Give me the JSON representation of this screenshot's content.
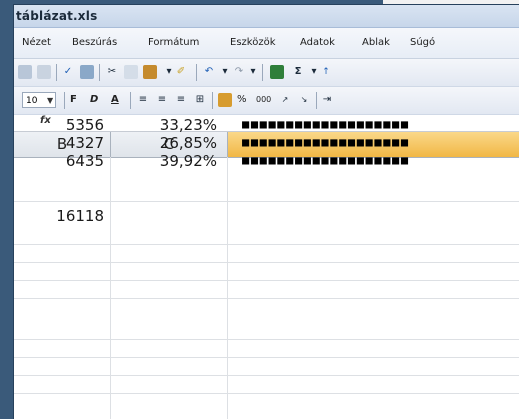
{
  "window": {
    "title": "táblázat.xls"
  },
  "menu": [
    "Nézet",
    "Beszúrás",
    "Formátum",
    "Eszközök",
    "Adatok",
    "Ablak",
    "Súgó"
  ],
  "toolbar": {
    "font_size": "10",
    "bold": "F",
    "italic": "D",
    "underline": "A",
    "percent": "%",
    "thousands": "000",
    "sigma": "Σ"
  },
  "formula_bar": {
    "fx": "fx"
  },
  "columns": {
    "b": "B",
    "c": "C"
  },
  "rows": [
    {
      "b": "",
      "c": "",
      "bar": ""
    },
    {
      "b": "",
      "c": "",
      "bar": ""
    },
    {
      "b": "5356",
      "c": "33,23%",
      "bar": "■■■■■■■■■■■■■■■■■■■"
    },
    {
      "b": "4327",
      "c": "26,85%",
      "bar": "■■■■■■■■■■■■■■■■■■■"
    },
    {
      "b": "6435",
      "c": "39,92%",
      "bar": "■■■■■■■■■■■■■■■■■■■"
    },
    {
      "b": "",
      "c": "",
      "bar": ""
    },
    {
      "b": "16118",
      "c": "",
      "bar": ""
    }
  ]
}
